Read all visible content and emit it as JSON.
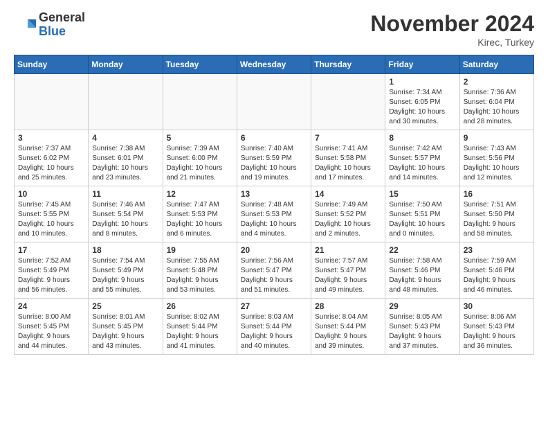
{
  "header": {
    "logo_general": "General",
    "logo_blue": "Blue",
    "month_title": "November 2024",
    "location": "Kirec, Turkey"
  },
  "weekdays": [
    "Sunday",
    "Monday",
    "Tuesday",
    "Wednesday",
    "Thursday",
    "Friday",
    "Saturday"
  ],
  "weeks": [
    [
      {
        "day": "",
        "info": ""
      },
      {
        "day": "",
        "info": ""
      },
      {
        "day": "",
        "info": ""
      },
      {
        "day": "",
        "info": ""
      },
      {
        "day": "",
        "info": ""
      },
      {
        "day": "1",
        "info": "Sunrise: 7:34 AM\nSunset: 6:05 PM\nDaylight: 10 hours\nand 30 minutes."
      },
      {
        "day": "2",
        "info": "Sunrise: 7:36 AM\nSunset: 6:04 PM\nDaylight: 10 hours\nand 28 minutes."
      }
    ],
    [
      {
        "day": "3",
        "info": "Sunrise: 7:37 AM\nSunset: 6:02 PM\nDaylight: 10 hours\nand 25 minutes."
      },
      {
        "day": "4",
        "info": "Sunrise: 7:38 AM\nSunset: 6:01 PM\nDaylight: 10 hours\nand 23 minutes."
      },
      {
        "day": "5",
        "info": "Sunrise: 7:39 AM\nSunset: 6:00 PM\nDaylight: 10 hours\nand 21 minutes."
      },
      {
        "day": "6",
        "info": "Sunrise: 7:40 AM\nSunset: 5:59 PM\nDaylight: 10 hours\nand 19 minutes."
      },
      {
        "day": "7",
        "info": "Sunrise: 7:41 AM\nSunset: 5:58 PM\nDaylight: 10 hours\nand 17 minutes."
      },
      {
        "day": "8",
        "info": "Sunrise: 7:42 AM\nSunset: 5:57 PM\nDaylight: 10 hours\nand 14 minutes."
      },
      {
        "day": "9",
        "info": "Sunrise: 7:43 AM\nSunset: 5:56 PM\nDaylight: 10 hours\nand 12 minutes."
      }
    ],
    [
      {
        "day": "10",
        "info": "Sunrise: 7:45 AM\nSunset: 5:55 PM\nDaylight: 10 hours\nand 10 minutes."
      },
      {
        "day": "11",
        "info": "Sunrise: 7:46 AM\nSunset: 5:54 PM\nDaylight: 10 hours\nand 8 minutes."
      },
      {
        "day": "12",
        "info": "Sunrise: 7:47 AM\nSunset: 5:53 PM\nDaylight: 10 hours\nand 6 minutes."
      },
      {
        "day": "13",
        "info": "Sunrise: 7:48 AM\nSunset: 5:53 PM\nDaylight: 10 hours\nand 4 minutes."
      },
      {
        "day": "14",
        "info": "Sunrise: 7:49 AM\nSunset: 5:52 PM\nDaylight: 10 hours\nand 2 minutes."
      },
      {
        "day": "15",
        "info": "Sunrise: 7:50 AM\nSunset: 5:51 PM\nDaylight: 10 hours\nand 0 minutes."
      },
      {
        "day": "16",
        "info": "Sunrise: 7:51 AM\nSunset: 5:50 PM\nDaylight: 9 hours\nand 58 minutes."
      }
    ],
    [
      {
        "day": "17",
        "info": "Sunrise: 7:52 AM\nSunset: 5:49 PM\nDaylight: 9 hours\nand 56 minutes."
      },
      {
        "day": "18",
        "info": "Sunrise: 7:54 AM\nSunset: 5:49 PM\nDaylight: 9 hours\nand 55 minutes."
      },
      {
        "day": "19",
        "info": "Sunrise: 7:55 AM\nSunset: 5:48 PM\nDaylight: 9 hours\nand 53 minutes."
      },
      {
        "day": "20",
        "info": "Sunrise: 7:56 AM\nSunset: 5:47 PM\nDaylight: 9 hours\nand 51 minutes."
      },
      {
        "day": "21",
        "info": "Sunrise: 7:57 AM\nSunset: 5:47 PM\nDaylight: 9 hours\nand 49 minutes."
      },
      {
        "day": "22",
        "info": "Sunrise: 7:58 AM\nSunset: 5:46 PM\nDaylight: 9 hours\nand 48 minutes."
      },
      {
        "day": "23",
        "info": "Sunrise: 7:59 AM\nSunset: 5:46 PM\nDaylight: 9 hours\nand 46 minutes."
      }
    ],
    [
      {
        "day": "24",
        "info": "Sunrise: 8:00 AM\nSunset: 5:45 PM\nDaylight: 9 hours\nand 44 minutes."
      },
      {
        "day": "25",
        "info": "Sunrise: 8:01 AM\nSunset: 5:45 PM\nDaylight: 9 hours\nand 43 minutes."
      },
      {
        "day": "26",
        "info": "Sunrise: 8:02 AM\nSunset: 5:44 PM\nDaylight: 9 hours\nand 41 minutes."
      },
      {
        "day": "27",
        "info": "Sunrise: 8:03 AM\nSunset: 5:44 PM\nDaylight: 9 hours\nand 40 minutes."
      },
      {
        "day": "28",
        "info": "Sunrise: 8:04 AM\nSunset: 5:44 PM\nDaylight: 9 hours\nand 39 minutes."
      },
      {
        "day": "29",
        "info": "Sunrise: 8:05 AM\nSunset: 5:43 PM\nDaylight: 9 hours\nand 37 minutes."
      },
      {
        "day": "30",
        "info": "Sunrise: 8:06 AM\nSunset: 5:43 PM\nDaylight: 9 hours\nand 36 minutes."
      }
    ]
  ]
}
